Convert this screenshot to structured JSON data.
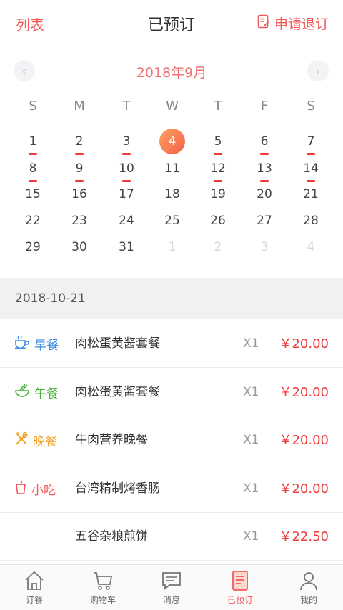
{
  "header": {
    "left_link": "列表",
    "title": "已预订",
    "right_action": "申请退订",
    "accent": "#f25a5a"
  },
  "calendar": {
    "month_label": "2018年9月",
    "weekdays": [
      "S",
      "M",
      "T",
      "W",
      "T",
      "F",
      "S"
    ],
    "weeks": [
      [
        {
          "d": "1",
          "mark": true
        },
        {
          "d": "2",
          "mark": true
        },
        {
          "d": "3",
          "mark": true
        },
        {
          "d": "4",
          "today": true
        },
        {
          "d": "5",
          "mark": true
        },
        {
          "d": "6",
          "mark": true
        },
        {
          "d": "7",
          "mark": true
        }
      ],
      [
        {
          "d": "8",
          "mark": true
        },
        {
          "d": "9",
          "mark": true
        },
        {
          "d": "10",
          "mark": true
        },
        {
          "d": "11"
        },
        {
          "d": "12",
          "mark": true
        },
        {
          "d": "13",
          "mark": true
        },
        {
          "d": "14",
          "mark": true
        }
      ],
      [
        {
          "d": "15"
        },
        {
          "d": "16"
        },
        {
          "d": "17"
        },
        {
          "d": "18"
        },
        {
          "d": "19"
        },
        {
          "d": "20"
        },
        {
          "d": "21"
        }
      ],
      [
        {
          "d": "22"
        },
        {
          "d": "23"
        },
        {
          "d": "24"
        },
        {
          "d": "25"
        },
        {
          "d": "26"
        },
        {
          "d": "27"
        },
        {
          "d": "28"
        }
      ],
      [
        {
          "d": "29"
        },
        {
          "d": "30"
        },
        {
          "d": "31"
        },
        {
          "d": "1",
          "muted": true
        },
        {
          "d": "2",
          "muted": true
        },
        {
          "d": "3",
          "muted": true
        },
        {
          "d": "4",
          "muted": true
        }
      ]
    ]
  },
  "selected_date": "2018-10-21",
  "orders": [
    {
      "meal": "早餐",
      "icon": "cup-icon",
      "meal_color": "#3b8de0",
      "dish": "肉松蛋黄酱套餐",
      "qty": "X1",
      "price": "￥20.00"
    },
    {
      "meal": "午餐",
      "icon": "bowl-icon",
      "meal_color": "#49b03a",
      "dish": "肉松蛋黄酱套餐",
      "qty": "X1",
      "price": "￥20.00"
    },
    {
      "meal": "晚餐",
      "icon": "utensils-icon",
      "meal_color": "#f0a020",
      "dish": "牛肉营养晚餐",
      "qty": "X1",
      "price": "￥20.00"
    },
    {
      "meal": "小吃",
      "icon": "drink-icon",
      "meal_color": "#f25a5a",
      "dish": "台湾精制烤香肠",
      "qty": "X1",
      "price": "￥20.00"
    },
    {
      "meal": "",
      "icon": "",
      "meal_color": "#f25a5a",
      "dish": "五谷杂粮煎饼",
      "qty": "X1",
      "price": "￥22.50"
    }
  ],
  "tabs": [
    {
      "label": "订餐",
      "icon": "home-icon",
      "active": false
    },
    {
      "label": "购物车",
      "icon": "cart-icon",
      "active": false
    },
    {
      "label": "消息",
      "icon": "message-icon",
      "active": false
    },
    {
      "label": "已预订",
      "icon": "booked-icon",
      "active": true
    },
    {
      "label": "我的",
      "icon": "user-icon",
      "active": false
    }
  ]
}
